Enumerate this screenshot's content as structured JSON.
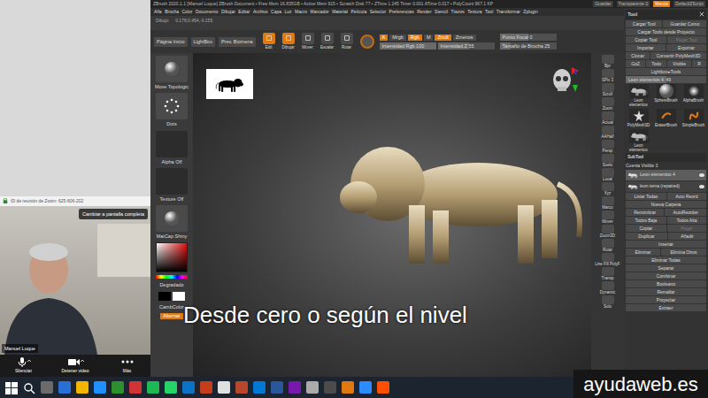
{
  "zbrush": {
    "title": "ZBrush 2020.1.1 [Manuel Luque]   ZBrush Document   ▪ Free Mem 16.835GB ▪ Active Mem 915 ▪ Scratch Disk 77 ▪ ZTime 1.245 Timer 0.001 ATime 0.017 ▪ PolyCount 967.1 KP",
    "title_right": [
      {
        "label": "Guardar",
        "selected": false
      },
      {
        "label": "Transparente 0",
        "selected": false
      },
      {
        "label": "Menús",
        "selected": true
      },
      {
        "label": "DefaultZScript",
        "selected": false
      }
    ],
    "menu": [
      "Alfa",
      "Brocha",
      "Color",
      "Documento",
      "Dibujar",
      "Editar",
      "Archivo",
      "Capa",
      "Luz",
      "Macro",
      "Marcador",
      "Material",
      "Película",
      "Selector",
      "Preferencias",
      "Render",
      "Stencil",
      "Trazos",
      "Textura",
      "Tool",
      "Transformar",
      "Zplugin"
    ],
    "strip": {
      "label": "Dibujo",
      "coords": "0.178,0.454,-0.155"
    },
    "shelf": {
      "buttons": [
        "Página Inicio",
        "LightBox",
        "Prev. Biomena"
      ],
      "tools": [
        {
          "label": "Edit",
          "selected": true
        },
        {
          "label": "Dibujar",
          "selected": true
        },
        {
          "label": "Mover",
          "selected": false
        },
        {
          "label": "Escalar",
          "selected": false
        },
        {
          "label": "Rotar",
          "selected": false
        }
      ],
      "modes": [
        {
          "label": "A",
          "selected": true
        },
        {
          "label": "Mrgb",
          "selected": false
        },
        {
          "label": "Rgb",
          "selected": true
        },
        {
          "label": "M",
          "selected": false
        },
        {
          "label": "Zmdl",
          "selected": true
        },
        {
          "label": "Zmenos",
          "selected": false
        }
      ],
      "sliders": [
        {
          "label": "Intensidad Rgb 100",
          "level": 1
        },
        {
          "label": "Intensidad Z 55",
          "level": 0.55
        }
      ],
      "draw_sliders": [
        {
          "label": "Punto Focal 0",
          "level": 0.5
        },
        {
          "label": "Tamaño de Brocha 25",
          "level": 0.2
        }
      ]
    },
    "palette": [
      {
        "label": "Move Topologic",
        "kind": "sphere"
      },
      {
        "label": "Dots",
        "kind": "dots"
      },
      {
        "label": "Alpha Off",
        "kind": "empty"
      },
      {
        "label": "Texture Off",
        "kind": "empty"
      },
      {
        "label": "MatCap Shiny",
        "kind": "sphere"
      }
    ],
    "color": {
      "label": "Degradado",
      "switch": "CambColor",
      "alternate": "Alternar"
    },
    "nav_tools": [
      "Bpr",
      "SPix 3",
      "Scroll",
      "Zoom",
      "Actual",
      "AAHalf",
      "Persp",
      "Suelo",
      "Local",
      "Xyz",
      "Marco",
      "Mover",
      "Zoom3D",
      "Rotar",
      "Line Fill PolyF",
      "Transp",
      "Dynamic",
      "Solo"
    ],
    "tool_panel": {
      "title": "Tool",
      "rows": [
        [
          {
            "label": "Cargar Tool",
            "disabled": false
          },
          {
            "label": "Guardar Como",
            "disabled": false
          }
        ],
        [
          {
            "label": "Cargar Tools desde Proyecto",
            "disabled": false
          }
        ],
        [
          {
            "label": "Copiar Tool",
            "disabled": false
          },
          {
            "label": "Pegar Tool",
            "disabled": true
          }
        ],
        [
          {
            "label": "Importar",
            "disabled": false
          },
          {
            "label": "Exportar",
            "disabled": false
          }
        ],
        [
          {
            "label": "Clonar",
            "disabled": false
          },
          {
            "label": "Convertir PolyMesh3D",
            "disabled": false
          }
        ],
        [
          {
            "label": "GoZ",
            "disabled": false
          },
          {
            "label": "Todo",
            "disabled": false
          },
          {
            "label": "Visible",
            "disabled": false
          },
          {
            "label": "R",
            "disabled": false
          }
        ],
        [
          {
            "label": "Lightbox▸Tools",
            "disabled": false
          }
        ]
      ],
      "slider": {
        "label": "Leon elementos 4. 49",
        "level": 0.5
      },
      "thumbs": [
        {
          "label": "Leon elementos",
          "kind": "lion"
        },
        {
          "label": "SphereBrush",
          "kind": "sphere"
        },
        {
          "label": "AlphaBrush",
          "kind": "alpha"
        },
        {
          "label": "PolyMesh3D",
          "kind": "star"
        },
        {
          "label": "EraserBrush",
          "kind": "eraser"
        },
        {
          "label": "SimpleBrush",
          "kind": "simple"
        },
        {
          "label": "Leon elementos",
          "kind": "lion"
        }
      ],
      "subtool": {
        "title": "SubTool",
        "visible": "Cuenta Visible 3",
        "items": [
          {
            "label": "Leon elementos 4",
            "selected": true
          },
          {
            "label": "leon tema (repaired)",
            "selected": false
          }
        ]
      },
      "actions": [
        [
          {
            "label": "Listar Todas",
            "disabled": false
          },
          {
            "label": "Auto Reord",
            "disabled": false
          }
        ],
        [
          {
            "label": "Nueva Carpeta",
            "disabled": false
          }
        ],
        [
          {
            "label": "Renombrar",
            "disabled": false
          },
          {
            "label": "AutoReorder",
            "disabled": false
          }
        ],
        [
          {
            "label": "Todos Baja",
            "disabled": false
          },
          {
            "label": "Todos Alta",
            "disabled": false
          }
        ],
        [
          {
            "label": "Copiar",
            "disabled": false
          },
          {
            "label": "Pegar",
            "disabled": true
          }
        ],
        [
          {
            "label": "Duplicar",
            "disabled": false
          },
          {
            "label": "Añadir",
            "disabled": false
          }
        ],
        [
          {
            "label": "Insertar",
            "disabled": false
          }
        ],
        [
          {
            "label": "Eliminar",
            "disabled": false
          },
          {
            "label": "Elimina Otros",
            "disabled": false
          }
        ],
        [
          {
            "label": "Eliminar Todas",
            "disabled": false
          }
        ],
        [
          {
            "label": "Separar",
            "disabled": false
          }
        ],
        [
          {
            "label": "Combinar",
            "disabled": false
          }
        ],
        [
          {
            "label": "Booleano",
            "disabled": false
          }
        ],
        [
          {
            "label": "Remallar",
            "disabled": false
          }
        ],
        [
          {
            "label": "Proyectar",
            "disabled": false
          }
        ],
        [
          {
            "label": "Extraer",
            "disabled": false
          }
        ]
      ]
    }
  },
  "caption": "Desde cero o según el nivel",
  "zoom": {
    "title": "ID de reunión de Zoom: 625-606-202",
    "fullscreen": "Cambiar a pantalla completa",
    "name": "Manuel Luque",
    "controls": [
      {
        "label": "Silenciar",
        "kind": "mic"
      },
      {
        "label": "Detener video",
        "kind": "camera"
      },
      {
        "label": "Más",
        "kind": "more"
      }
    ]
  },
  "watermark": "ayudaweb.es"
}
